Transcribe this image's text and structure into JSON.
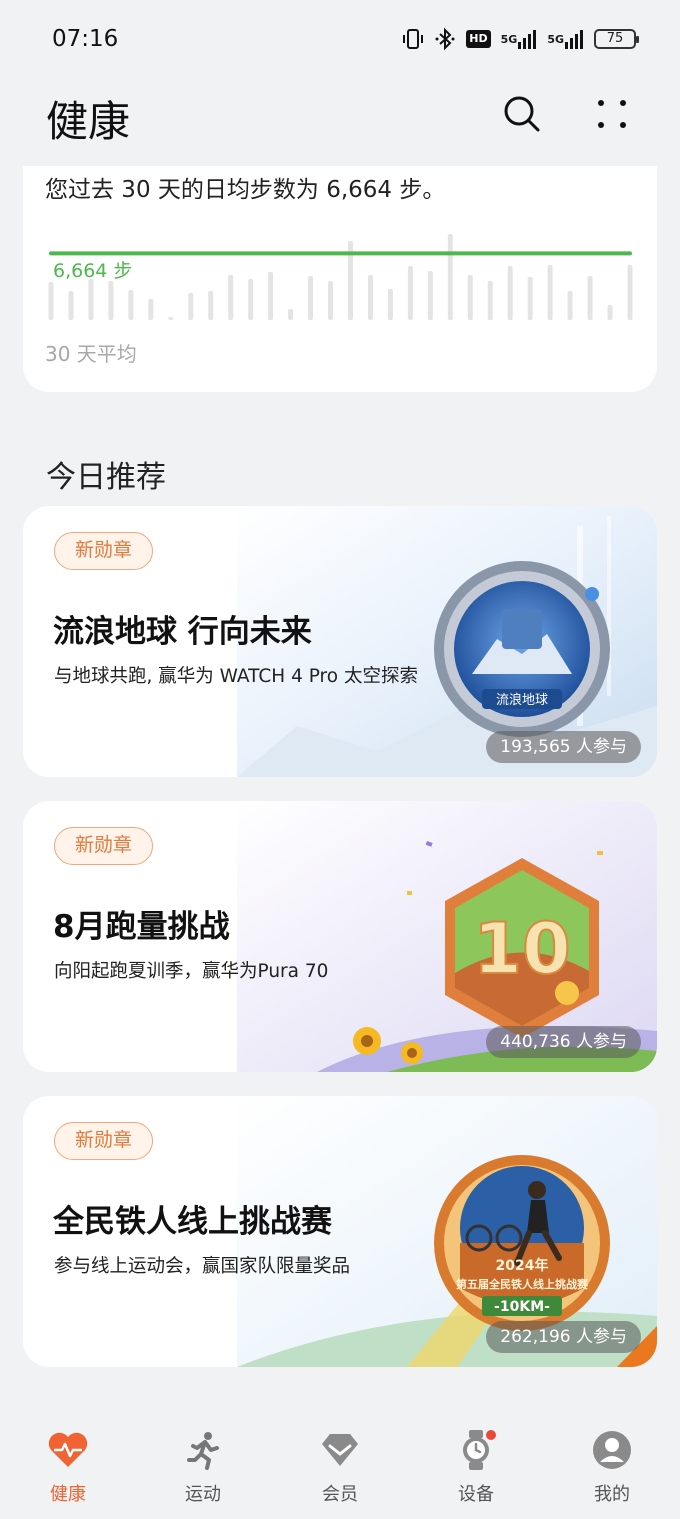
{
  "status_bar": {
    "time": "07:16",
    "battery": "75",
    "hd_label": "HD",
    "net1": "5G",
    "net2": "5G"
  },
  "header": {
    "title": "健康"
  },
  "steps": {
    "summary": "您过去 30 天的日均步数为 6,664 步。",
    "average_label": "6,664 步",
    "caption": "30 天平均",
    "chart_data": {
      "type": "bar",
      "average": 6664,
      "values": [
        3800,
        2900,
        4100,
        3900,
        3000,
        2100,
        0,
        2700,
        2900,
        4500,
        4100,
        4800,
        1100,
        4400,
        3900,
        7900,
        4500,
        3100,
        5400,
        4900,
        8600,
        4500,
        3900,
        5400,
        4300,
        5500,
        2900,
        4400,
        1500,
        5500
      ],
      "accent_color": "#4cb84d",
      "bar_color": "#e4e4e4"
    }
  },
  "section": {
    "title": "今日推荐"
  },
  "promos": [
    {
      "badge": "新勋章",
      "title": "流浪地球 行向未来",
      "subtitle": "与地球共跑, 赢华为 WATCH 4 Pro 太空探索",
      "participants": "193,565 人参与",
      "medal_text": "流浪地球"
    },
    {
      "badge": "新勋章",
      "title": "8月跑量挑战",
      "subtitle": "向阳起跑夏训季，赢华为Pura 70",
      "participants": "440,736 人参与",
      "medal_text": "10"
    },
    {
      "badge": "新勋章",
      "title": "全民铁人线上挑战赛",
      "subtitle": "参与线上运动会，赢国家队限量奖品",
      "participants": "262,196 人参与",
      "medal_year": "2024年",
      "medal_text": "第五届全民铁人线上挑战赛",
      "medal_distance": "-10KM-"
    }
  ],
  "nav": [
    {
      "label": "健康",
      "icon": "heart-pulse-icon",
      "active": true
    },
    {
      "label": "运动",
      "icon": "running-person-icon",
      "active": false
    },
    {
      "label": "会员",
      "icon": "diamond-icon",
      "active": false
    },
    {
      "label": "设备",
      "icon": "watch-icon",
      "active": false
    },
    {
      "label": "我的",
      "icon": "person-avatar-icon",
      "active": false
    }
  ]
}
